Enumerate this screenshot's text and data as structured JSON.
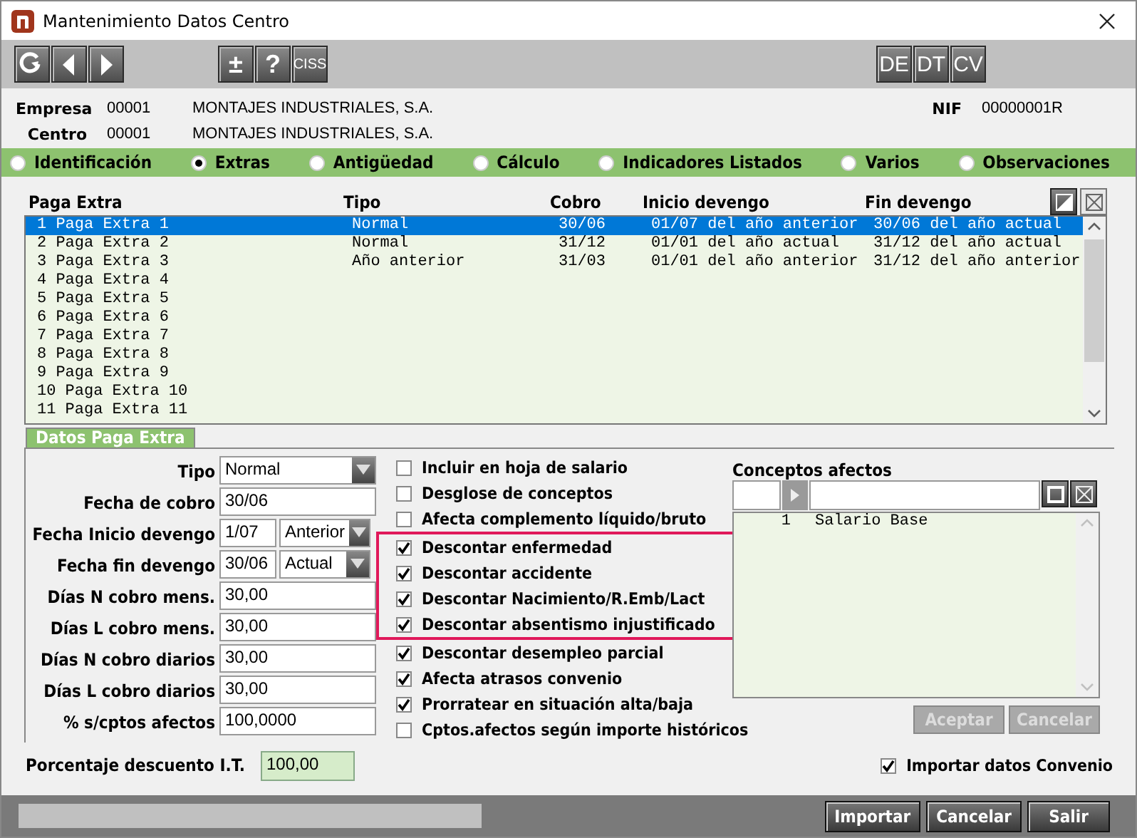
{
  "window": {
    "title": "Mantenimiento Datos Centro"
  },
  "toolbar": {
    "text_buttons": [
      "±",
      "?",
      "CISS"
    ],
    "right_buttons": [
      "DE",
      "DT",
      "CV"
    ]
  },
  "header": {
    "empresa": {
      "label": "Empresa",
      "code": "00001",
      "name": "MONTAJES INDUSTRIALES, S.A."
    },
    "centro": {
      "label": "Centro",
      "code": "00001",
      "name": "MONTAJES INDUSTRIALES, S.A."
    },
    "nif": {
      "label": "NIF",
      "value": "00000001R"
    }
  },
  "sections": [
    {
      "label": "Identificación",
      "selected": false
    },
    {
      "label": "Extras",
      "selected": true
    },
    {
      "label": "Antigüedad",
      "selected": false
    },
    {
      "label": "Cálculo",
      "selected": false
    },
    {
      "label": "Indicadores Listados",
      "selected": false
    },
    {
      "label": "Varios",
      "selected": false
    },
    {
      "label": "Observaciones",
      "selected": false
    }
  ],
  "table": {
    "columns": [
      "Paga Extra",
      "Tipo",
      "Cobro",
      "Inicio devengo",
      "Fin devengo"
    ],
    "rows": [
      {
        "cells": [
          "1 Paga Extra 1",
          "Normal",
          "30/06",
          "01/07 del año anterior",
          "30/06 del año actual"
        ],
        "selected": true
      },
      {
        "cells": [
          "2 Paga Extra 2",
          "Normal",
          "31/12",
          "01/01 del año actual",
          "31/12 del año actual"
        ],
        "selected": false
      },
      {
        "cells": [
          "3 Paga Extra 3",
          "Año anterior",
          "31/03",
          "01/01 del año anterior",
          "31/12 del año anterior"
        ],
        "selected": false
      },
      {
        "cells": [
          "4 Paga Extra 4"
        ],
        "selected": false
      },
      {
        "cells": [
          "5 Paga Extra 5"
        ],
        "selected": false
      },
      {
        "cells": [
          "6 Paga Extra 6"
        ],
        "selected": false
      },
      {
        "cells": [
          "7 Paga Extra 7"
        ],
        "selected": false
      },
      {
        "cells": [
          "8 Paga Extra 8"
        ],
        "selected": false
      },
      {
        "cells": [
          "9 Paga Extra 9"
        ],
        "selected": false
      },
      {
        "cells": [
          "10 Paga Extra 10"
        ],
        "selected": false
      },
      {
        "cells": [
          "11 Paga Extra 11"
        ],
        "selected": false
      }
    ]
  },
  "datos": {
    "title": "Datos Paga Extra",
    "fields": [
      {
        "label": "Tipo",
        "kind": "select",
        "value": "Normal"
      },
      {
        "label": "Fecha de cobro",
        "kind": "text",
        "value": "30/06"
      },
      {
        "label": "Fecha Inicio devengo",
        "kind": "date_select",
        "value": "1/07",
        "option": "Anterior"
      },
      {
        "label": "Fecha fin devengo",
        "kind": "date_select",
        "value": "30/06",
        "option": "Actual"
      },
      {
        "label": "Días N cobro mens.",
        "kind": "text",
        "value": "30,00"
      },
      {
        "label": "Días L cobro mens.",
        "kind": "text",
        "value": "30,00"
      },
      {
        "label": "Días N cobro diarios",
        "kind": "text",
        "value": "30,00"
      },
      {
        "label": "Días L cobro diarios",
        "kind": "text",
        "value": "30,00"
      },
      {
        "label": "% s/cptos afectos",
        "kind": "text",
        "value": "100,0000"
      }
    ],
    "checkboxes": [
      {
        "label": "Incluir en hoja de salario",
        "checked": false,
        "highlighted": false
      },
      {
        "label": "Desglose de conceptos",
        "checked": false,
        "highlighted": false
      },
      {
        "label": "Afecta complemento líquido/bruto",
        "checked": false,
        "highlighted": false
      },
      {
        "label": "Descontar enfermedad",
        "checked": true,
        "highlighted": true
      },
      {
        "label": "Descontar accidente",
        "checked": true,
        "highlighted": true
      },
      {
        "label": "Descontar Nacimiento/R.Emb/Lact",
        "checked": true,
        "highlighted": true
      },
      {
        "label": "Descontar absentismo injustificado",
        "checked": true,
        "highlighted": true
      },
      {
        "label": "Descontar desempleo parcial",
        "checked": true,
        "highlighted": false
      },
      {
        "label": "Afecta atrasos convenio",
        "checked": true,
        "highlighted": false
      },
      {
        "label": "Prorratear en situación alta/baja",
        "checked": true,
        "highlighted": false
      },
      {
        "label": "Cptos.afectos según importe históricos",
        "checked": false,
        "highlighted": false
      }
    ],
    "conceptos": {
      "title": "Conceptos afectos",
      "rows": [
        {
          "num": "1",
          "name": "Salario Base"
        }
      ],
      "buttons": [
        {
          "label": "Aceptar",
          "disabled": true
        },
        {
          "label": "Cancelar",
          "disabled": true
        }
      ]
    }
  },
  "porcentaje": {
    "label": "Porcentaje descuento I.T.",
    "value": "100,00"
  },
  "importar_convenio": {
    "label": "Importar datos Convenio",
    "checked": true
  },
  "footer_buttons": [
    "Importar",
    "Cancelar",
    "Salir"
  ]
}
